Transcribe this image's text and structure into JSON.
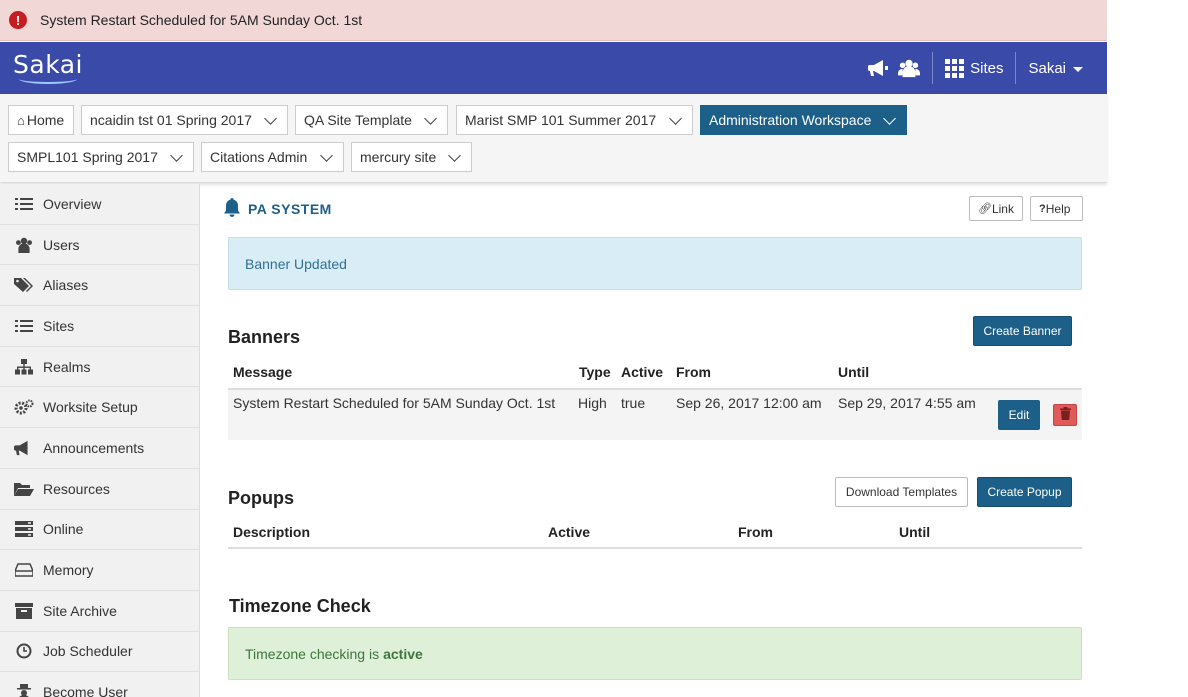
{
  "alert": {
    "icon": "exclamation-circle-icon",
    "symbol": "!",
    "text": "System Restart Scheduled for 5AM Sunday Oct. 1st",
    "color": "#c51d21"
  },
  "header": {
    "logo": "Sakai",
    "icons": [
      "megaphone-icon",
      "users-icon"
    ],
    "sites_label": "Sites",
    "user_label": "Sakai",
    "color": "#3a4aa9"
  },
  "site_tabs": [
    {
      "label": "Home"
    },
    {
      "label": "ncaidin tst 01 Spring 2017"
    },
    {
      "label": "QA Site Template"
    },
    {
      "label": "Marist SMP 101 Summer 2017"
    },
    {
      "label": "Administration Workspace",
      "active": true
    },
    {
      "label": "SMPL101 Spring 2017"
    },
    {
      "label": "Citations Admin"
    },
    {
      "label": "mercury site"
    }
  ],
  "sidebar": {
    "items": [
      {
        "label": "Overview",
        "icon": "list-icon"
      },
      {
        "label": "Users",
        "icon": "users-icon"
      },
      {
        "label": "Aliases",
        "icon": "tags-icon"
      },
      {
        "label": "Sites",
        "icon": "list-icon"
      },
      {
        "label": "Realms",
        "icon": "sitemap-icon"
      },
      {
        "label": "Worksite Setup",
        "icon": "gears-icon"
      },
      {
        "label": "Announcements",
        "icon": "megaphone-icon"
      },
      {
        "label": "Resources",
        "icon": "folder-icon"
      },
      {
        "label": "Online",
        "icon": "server-icon"
      },
      {
        "label": "Memory",
        "icon": "drive-icon"
      },
      {
        "label": "Site Archive",
        "icon": "archive-icon"
      },
      {
        "label": "Job Scheduler",
        "icon": "clock-icon"
      },
      {
        "label": "Become User",
        "icon": "user-secret-icon"
      }
    ]
  },
  "main": {
    "tool_title": "PA SYSTEM",
    "link_label": "Link",
    "help_label": "Help",
    "info_message": "Banner Updated",
    "banners": {
      "heading": "Banners",
      "create_label": "Create Banner",
      "columns": [
        "Message",
        "Type",
        "Active",
        "From",
        "Until"
      ],
      "rows": [
        {
          "message": "System Restart Scheduled for 5AM Sunday Oct. 1st",
          "type": "High",
          "active": "true",
          "from": "Sep 26, 2017 12:00 am",
          "until": "Sep 29, 2017 4:55 am",
          "edit_label": "Edit"
        }
      ]
    },
    "popups": {
      "heading": "Popups",
      "download_label": "Download Templates",
      "create_label": "Create Popup",
      "columns": [
        "Description",
        "Active",
        "From",
        "Until"
      ]
    },
    "timezone": {
      "heading": "Timezone Check",
      "message": "Timezone checking is",
      "status": "active"
    }
  }
}
